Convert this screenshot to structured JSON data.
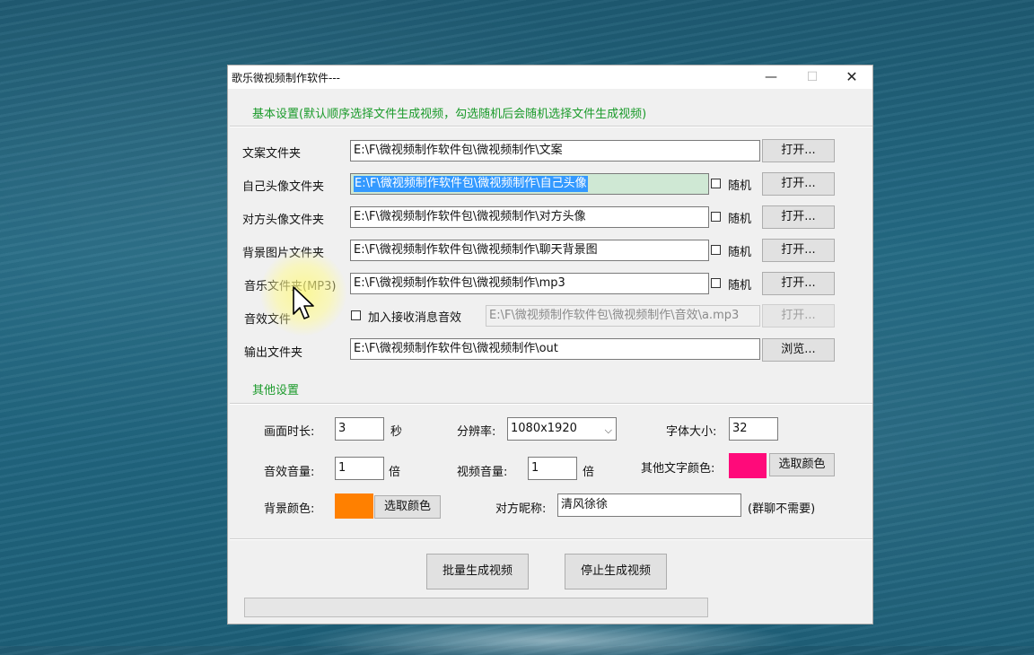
{
  "window": {
    "title": "歌乐微视频制作软件---",
    "controls": {
      "minimize": "—",
      "maximize": "☐",
      "close": "✕"
    }
  },
  "basic": {
    "heading": "基本设置(默认顺序选择文件生成视频，勾选随机后会随机选择文件生成视频)",
    "rows": {
      "copy": {
        "label": "文案文件夹",
        "value": "E:\\F\\微视频制作软件包\\微视频制作\\文案",
        "button": "打开..."
      },
      "self_avatar": {
        "label": "自己头像文件夹",
        "value": "E:\\F\\微视频制作软件包\\微视频制作\\自己头像",
        "random": "随机",
        "button": "打开..."
      },
      "other_avatar": {
        "label": "对方头像文件夹",
        "value": "E:\\F\\微视频制作软件包\\微视频制作\\对方头像",
        "random": "随机",
        "button": "打开..."
      },
      "background": {
        "label": "背景图片文件夹",
        "value": "E:\\F\\微视频制作软件包\\微视频制作\\聊天背景图",
        "random": "随机",
        "button": "打开..."
      },
      "music": {
        "label": "音乐文件夹(MP3)",
        "value": "E:\\F\\微视频制作软件包\\微视频制作\\mp3",
        "random": "随机",
        "button": "打开..."
      },
      "sfx": {
        "label": "音效文件",
        "checkbox": "加入接收消息音效",
        "value": "E:\\F\\微视频制作软件包\\微视频制作\\音效\\a.mp3",
        "button": "打开..."
      },
      "output": {
        "label": "输出文件夹",
        "value": "E:\\F\\微视频制作软件包\\微视频制作\\out",
        "button": "浏览..."
      }
    }
  },
  "other": {
    "heading": "其他设置",
    "duration_label": "画面时长:",
    "duration_value": "3",
    "duration_unit": "秒",
    "resolution_label": "分辨率:",
    "resolution_value": "1080x1920",
    "fontsize_label": "字体大小:",
    "fontsize_value": "32",
    "sfx_volume_label": "音效音量:",
    "sfx_volume_value": "1",
    "sfx_volume_unit": "倍",
    "video_volume_label": "视频音量:",
    "video_volume_value": "1",
    "video_volume_unit": "倍",
    "text_color_label": "其他文字颜色:",
    "text_color_button": "选取颜色",
    "text_color": "#ff0a7a",
    "bg_color_label": "背景颜色:",
    "bg_color_button": "选取颜色",
    "bg_color": "#ff8000",
    "nickname_label": "对方昵称:",
    "nickname_value": "清风徐徐",
    "nickname_note": "(群聊不需要)"
  },
  "actions": {
    "batch_generate": "批量生成视频",
    "stop_generate": "停止生成视频"
  },
  "progress_value": 0
}
